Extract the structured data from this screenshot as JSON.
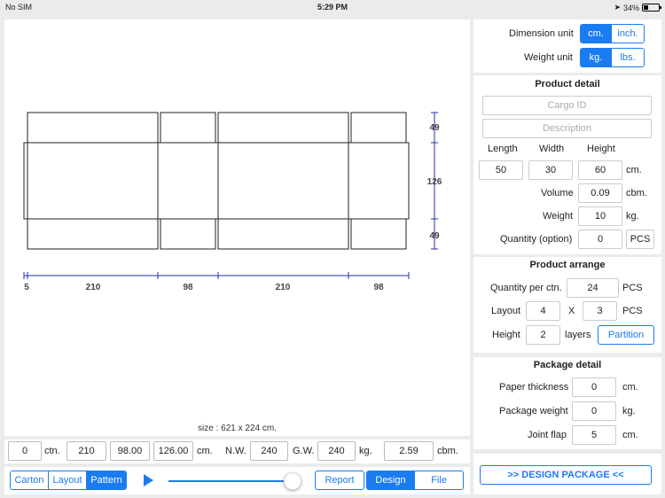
{
  "status_bar": {
    "carrier": "No SIM",
    "time": "5:29 PM",
    "battery": "34%",
    "battery_level": 0.34
  },
  "canvas": {
    "dims_right": [
      "49",
      "126",
      "49"
    ],
    "dims_bottom": [
      "5",
      "210",
      "98",
      "210",
      "98"
    ],
    "size_text": "size : 621 x 224 cm."
  },
  "summary": {
    "ctn_value": "0",
    "ctn_label": "ctn.",
    "dim_l": "210",
    "dim_w": "98.00",
    "dim_h": "126.00",
    "dim_unit": "cm.",
    "nw_label": "N.W.",
    "nw_value": "240",
    "gw_label": "G.W.",
    "gw_value": "240",
    "weight_unit": "kg.",
    "cbm_value": "2.59",
    "cbm_label": "cbm."
  },
  "toolbar": {
    "views": [
      "Carton",
      "Layout",
      "Pattern"
    ],
    "active_view": "Pattern",
    "report_label": "Report",
    "modes": [
      "Design",
      "File"
    ],
    "active_mode": "Design",
    "slider_value": 0.93
  },
  "units": {
    "dimension_label": "Dimension unit",
    "dimension_options": [
      "cm.",
      "inch."
    ],
    "dimension_selected": "cm.",
    "weight_label": "Weight unit",
    "weight_options": [
      "kg.",
      "lbs."
    ],
    "weight_selected": "kg."
  },
  "product_detail": {
    "title": "Product detail",
    "cargo_id_placeholder": "Cargo ID",
    "description_placeholder": "Description",
    "length_label": "Length",
    "width_label": "Width",
    "height_label": "Height",
    "length": "50",
    "width": "30",
    "height": "60",
    "dim_unit": "cm.",
    "volume_label": "Volume",
    "volume": "0.09",
    "volume_unit": "cbm.",
    "weight_label": "Weight",
    "weight": "10",
    "weight_unit": "kg.",
    "quantity_label": "Quantity (option)",
    "quantity": "0",
    "quantity_unit": "PCS"
  },
  "product_arrange": {
    "title": "Product arrange",
    "qty_per_ctn_label": "Quantity per ctn.",
    "qty_per_ctn": "24",
    "qty_unit": "PCS",
    "layout_label": "Layout",
    "layout_a": "4",
    "layout_x": "X",
    "layout_b": "3",
    "layout_unit": "PCS",
    "height_label": "Height",
    "height_layers": "2",
    "layers_label": "layers",
    "partition_label": "Partition"
  },
  "package_detail": {
    "title": "Package detail",
    "paper_label": "Paper thickness",
    "paper_value": "0",
    "paper_unit": "cm.",
    "pkg_weight_label": "Package weight",
    "pkg_weight_value": "0",
    "pkg_weight_unit": "kg.",
    "joint_label": "Joint flap",
    "joint_value": "5",
    "joint_unit": "cm."
  },
  "design_package_label": ">> DESIGN PACKAGE <<",
  "colors": {
    "accent": "#1a7cf0",
    "dimension_line": "#2233aa"
  }
}
